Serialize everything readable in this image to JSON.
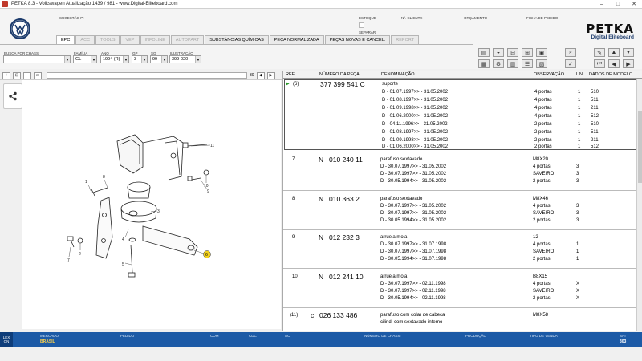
{
  "window": {
    "title": "PETKA 8.3 - Volkswagen Atualização 1439 / 981 - www.Digital-Eliteboard.com",
    "min": "–",
    "max": "□",
    "close": "✕"
  },
  "header": {
    "sugestao_label": "SUGESTÃO PI",
    "estoque_label": "ESTOQUE",
    "separar_label": "SEPARAR",
    "cliente_label": "Nº. CLIENTE",
    "orcamento_label": "ORÇAMENTO",
    "ficha_label": "FICHA DE PEDIDO",
    "logo_main": "PETKA",
    "logo_sub": "Digital Eliteboard"
  },
  "tabs": [
    {
      "label": "EPC",
      "state": "active"
    },
    {
      "label": "ACC",
      "state": "disabled"
    },
    {
      "label": "TOOLS",
      "state": "disabled"
    },
    {
      "label": "VEP",
      "state": "disabled"
    },
    {
      "label": "INFOLINE",
      "state": "disabled"
    },
    {
      "label": "AUTOPART",
      "state": "disabled"
    },
    {
      "label": "SUBSTÂNCIAS QUÍMICAS",
      "state": "normal"
    },
    {
      "label": "PEÇA NORMALIZADA",
      "state": "normal"
    },
    {
      "label": "PEÇAS NOVAS E CANCEL.",
      "state": "normal"
    },
    {
      "label": "REPORT",
      "state": "disabled"
    }
  ],
  "filters": {
    "chassi_label": "BUSCA POR CHASSI",
    "familia_label": "FAMÍLIA",
    "familia_value": "GL",
    "ano_label": "ANO",
    "ano_value": "1994 (R)",
    "gp_label": "GP",
    "gp_value": "3",
    "sg_label": "SG",
    "sg_value": "99",
    "ilustracao_label": "ILUSTRAÇÃO",
    "ilustracao_value": "399-020"
  },
  "imgtools": {
    "zoom_value": "30"
  },
  "listing": {
    "headers": {
      "ref": "REF",
      "numero": "NÚMERO DA PEÇA",
      "denominacao": "DENOMINAÇÃO",
      "observacao": "OBSERVAÇÃO",
      "un": "UN",
      "dados": "DADOS DE MODELO"
    },
    "selected_marker": "▶",
    "blocks": [
      {
        "ref": "(6)",
        "prefix": "",
        "number": "377 399 541 C",
        "name": "suporte",
        "obs": "",
        "lines": [
          {
            "d": "D - 01.07.1997>> - 31.05.2002",
            "obs": "4 portas",
            "un": "1",
            "m": "510"
          },
          {
            "d": "D - 01.08.1997>> - 31.05.2002",
            "obs": "4 portas",
            "un": "1",
            "m": "511"
          },
          {
            "d": "D - 01.09.1998>> - 31.05.2002",
            "obs": "4 portas",
            "un": "1",
            "m": "211"
          },
          {
            "d": "D - 01.06.2000>> - 31.05.2002",
            "obs": "4 portas",
            "un": "1",
            "m": "512"
          },
          {
            "d": "D - 04.11.1996>> - 31.05.2002",
            "obs": "2 portas",
            "un": "1",
            "m": "510"
          },
          {
            "d": "D - 01.08.1997>> - 31.05.2002",
            "obs": "2 portas",
            "un": "1",
            "m": "511"
          },
          {
            "d": "D - 01.09.1998>> - 31.05.2002",
            "obs": "2 portas",
            "un": "1",
            "m": "211"
          },
          {
            "d": "D - 01.06.2000>> - 31.05.2002",
            "obs": "2 portas",
            "un": "1",
            "m": "512"
          }
        ]
      },
      {
        "ref": "7",
        "prefix": "N",
        "number": "010 240 11",
        "name": "parafuso sextavado",
        "obs": "M8X20",
        "lines": [
          {
            "d": "D - 30.07.1997>> - 31.05.2002",
            "obs": "4 portas",
            "un": "3",
            "m": ""
          },
          {
            "d": "D - 30.07.1997>> - 31.05.2002",
            "obs": "SAVEIRO",
            "un": "3",
            "m": ""
          },
          {
            "d": "D - 30.05.1994>> - 31.05.2002",
            "obs": "2 portas",
            "un": "3",
            "m": ""
          }
        ]
      },
      {
        "ref": "8",
        "prefix": "N",
        "number": "010 363 2",
        "name": "parafuso sextavado",
        "obs": "M8X46",
        "lines": [
          {
            "d": "D - 30.07.1997>> - 31.05.2002",
            "obs": "4 portas",
            "un": "3",
            "m": ""
          },
          {
            "d": "D - 30.07.1997>> - 31.05.2002",
            "obs": "SAVEIRO",
            "un": "3",
            "m": ""
          },
          {
            "d": "D - 30.05.1994>> - 31.05.2002",
            "obs": "2 portas",
            "un": "3",
            "m": ""
          }
        ]
      },
      {
        "ref": "9",
        "prefix": "N",
        "number": "012 232 3",
        "name": "arruela mola",
        "obs": "12",
        "lines": [
          {
            "d": "D - 30.07.1997>> - 31.07.1998",
            "obs": "4 portas",
            "un": "1",
            "m": ""
          },
          {
            "d": "D - 30.07.1997>> - 31.07.1998",
            "obs": "SAVEIRO",
            "un": "1",
            "m": ""
          },
          {
            "d": "D - 30.05.1994>> - 31.07.1998",
            "obs": "2 portas",
            "un": "1",
            "m": ""
          }
        ]
      },
      {
        "ref": "10",
        "prefix": "N",
        "number": "012 241 10",
        "name": "arruela mola",
        "obs": "B8X15",
        "lines": [
          {
            "d": "D - 30.07.1997>> - 02.11.1998",
            "obs": "4 portas",
            "un": "X",
            "m": ""
          },
          {
            "d": "D - 30.07.1997>> - 02.11.1998",
            "obs": "SAVEIRO",
            "un": "X",
            "m": ""
          },
          {
            "d": "D - 30.05.1994>> - 02.11.1998",
            "obs": "2 portas",
            "un": "X",
            "m": ""
          }
        ]
      },
      {
        "ref": "(11)",
        "prefix": "c",
        "number": "026 133 486",
        "name": "parafuso com colar de cabeca",
        "name2": "cilind. com sextavado interno",
        "obs": "M8X58",
        "lines": []
      }
    ]
  },
  "diagram": {
    "callouts": [
      "11",
      "10",
      "9",
      "8",
      "7",
      "3",
      "4",
      "5",
      "6",
      "2",
      "1"
    ]
  },
  "status": {
    "left_box": "LEX ON",
    "mercado_label": "MERCADO",
    "mercado_value": "BRASIL",
    "pedido_label": "PEDIDO",
    "com_label": "COM",
    "cdc_label": "CDC",
    "ac_label": "AC",
    "chassi_label": "NÚMERO DE CHASSI",
    "producao_label": "PRODUÇÃO",
    "venda_label": "TIPO DE VENDA",
    "sat_label": "SAT",
    "sat_value": "303"
  }
}
